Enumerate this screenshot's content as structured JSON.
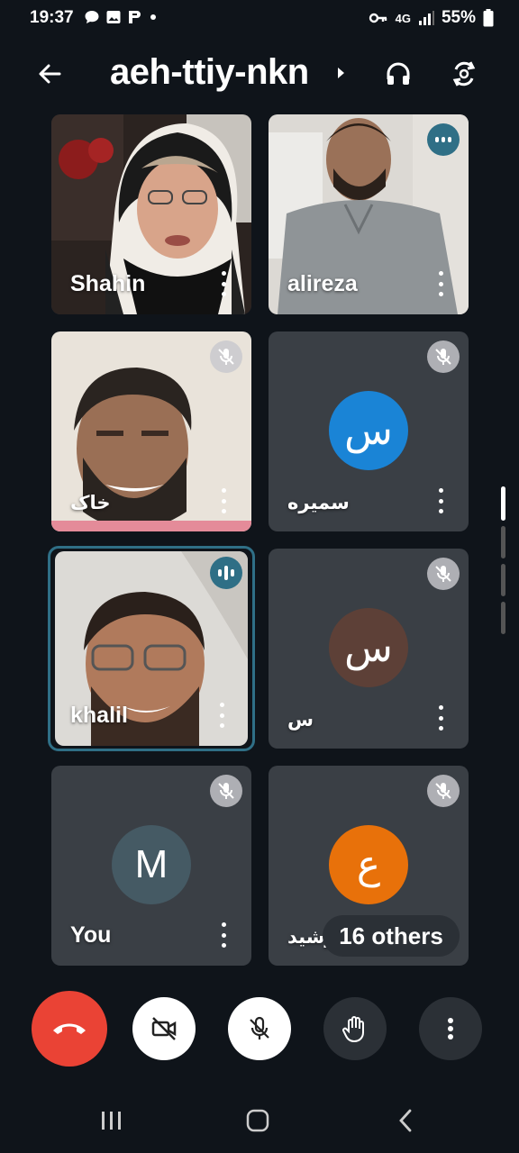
{
  "status_bar": {
    "time": "19:37",
    "network": "4G",
    "battery": "55%"
  },
  "header": {
    "meeting_code": "aeh-ttiy-nkn"
  },
  "participants": [
    {
      "name": "Shahin",
      "avatar_letter": "",
      "mic": "on"
    },
    {
      "name": "alireza",
      "avatar_letter": "",
      "mic": "speaking"
    },
    {
      "name": "خاک",
      "avatar_letter": "",
      "mic": "muted"
    },
    {
      "name": "سمیره",
      "avatar_letter": "س",
      "avatar_color": "#1a73e8",
      "mic": "muted"
    },
    {
      "name": "khalil",
      "avatar_letter": "",
      "mic": "speaking"
    },
    {
      "name": "س",
      "avatar_letter": "س",
      "avatar_color": "#5d4037",
      "mic": "muted"
    },
    {
      "name": "You",
      "avatar_letter": "M",
      "avatar_color": "#455a64",
      "mic": "muted"
    },
    {
      "name": "رشید",
      "avatar_letter": "ع",
      "avatar_color": "#e8710a",
      "mic": "muted"
    }
  ],
  "others_chip": "16 others",
  "controls": [
    "leave-call",
    "camera-off",
    "mic-off",
    "raise-hand",
    "more-options"
  ]
}
